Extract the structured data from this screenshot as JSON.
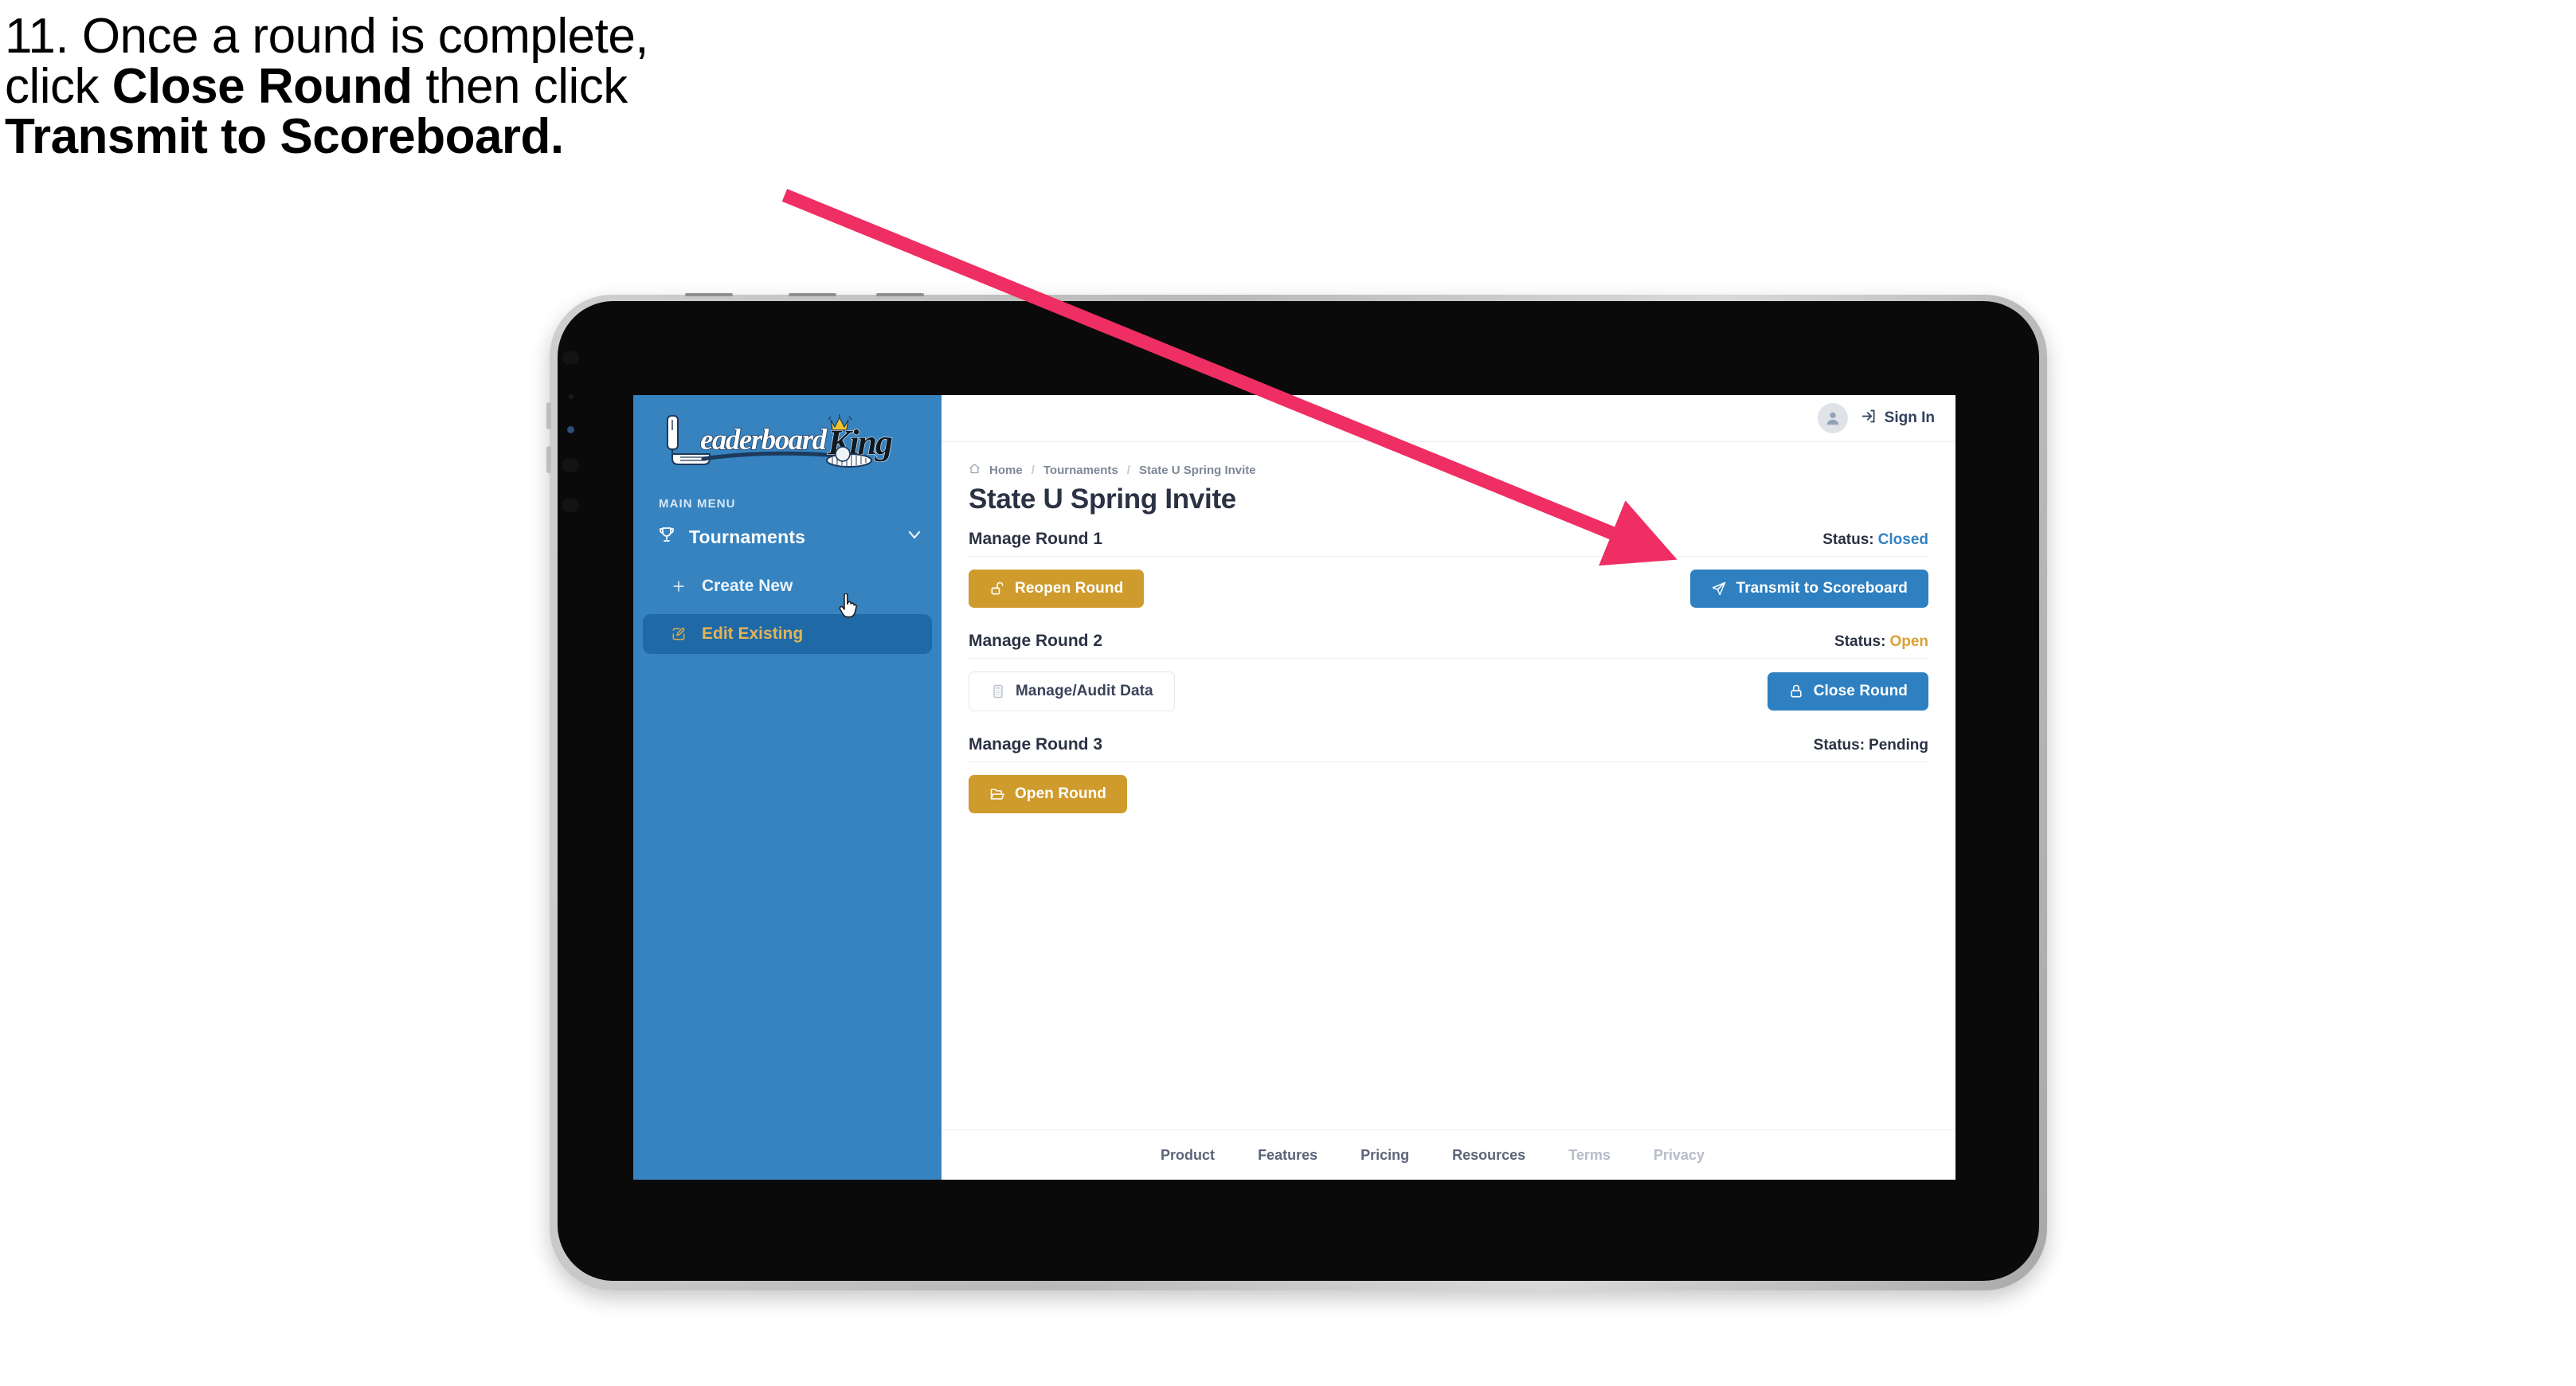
{
  "caption": {
    "line1_plain": "11. Once a round is complete,",
    "line2_pre": "click ",
    "line2_bold": "Close Round",
    "line2_post": " then click",
    "line3_bold": "Transmit to Scoreboard."
  },
  "annotation": {
    "arrow_color": "#ef2e63",
    "arrow_from": "985,245",
    "arrow_to": "2100,700"
  },
  "device": {
    "type": "tablet",
    "frame_color": "#c2c2c2",
    "screen_color": "#0a0a0a"
  },
  "sidebar": {
    "logo_primary": "Leaderboard",
    "logo_secondary": "King",
    "menu_label": "MAIN MENU",
    "background": "#3683c0",
    "items": [
      {
        "label": "Tournaments",
        "icon": "trophy-icon",
        "chevron": "chevron-down-icon",
        "active": false
      },
      {
        "label": "Create New",
        "icon": "plus-icon",
        "active": false
      },
      {
        "label": "Edit Existing",
        "icon": "pencil-square-icon",
        "active": true
      }
    ]
  },
  "topbar": {
    "avatar_icon": "user-avatar-icon",
    "signin_icon": "sign-in-icon",
    "signin_label": "Sign In"
  },
  "breadcrumb": {
    "home_icon": "home-icon",
    "items": [
      "Home",
      "Tournaments",
      "State U Spring Invite"
    ],
    "separator": "/"
  },
  "page": {
    "title": "State U Spring Invite"
  },
  "rounds": [
    {
      "title": "Manage Round 1",
      "status_label": "Status:",
      "status_value": "Closed",
      "status_kind": "closed",
      "left_button": {
        "label": "Reopen Round",
        "icon": "unlock-icon",
        "style": "gold"
      },
      "right_button": {
        "label": "Transmit to Scoreboard",
        "icon": "paper-plane-icon",
        "style": "blue"
      }
    },
    {
      "title": "Manage Round 2",
      "status_label": "Status:",
      "status_value": "Open",
      "status_kind": "open",
      "left_button": {
        "label": "Manage/Audit Data",
        "icon": "calculator-icon",
        "style": "ghost"
      },
      "right_button": {
        "label": "Close Round",
        "icon": "lock-icon",
        "style": "blue"
      }
    },
    {
      "title": "Manage Round 3",
      "status_label": "Status:",
      "status_value": "Pending",
      "status_kind": "pending",
      "left_button": {
        "label": "Open Round",
        "icon": "folder-open-icon",
        "style": "gold"
      },
      "right_button": null
    }
  ],
  "footer": {
    "links": [
      {
        "label": "Product",
        "muted": false
      },
      {
        "label": "Features",
        "muted": false
      },
      {
        "label": "Pricing",
        "muted": false
      },
      {
        "label": "Resources",
        "muted": false
      },
      {
        "label": "Terms",
        "muted": true
      },
      {
        "label": "Privacy",
        "muted": true
      }
    ]
  },
  "cursor": {
    "type": "pointing-hand-cursor"
  },
  "colors": {
    "gold": "#cf9b2d",
    "blue": "#2e80c1",
    "sidebar_blue": "#3683c0",
    "sidebar_active": "#1f6aa6",
    "active_text": "#e2b457",
    "navy": "#2b3244",
    "pink": "#ef2e63"
  }
}
